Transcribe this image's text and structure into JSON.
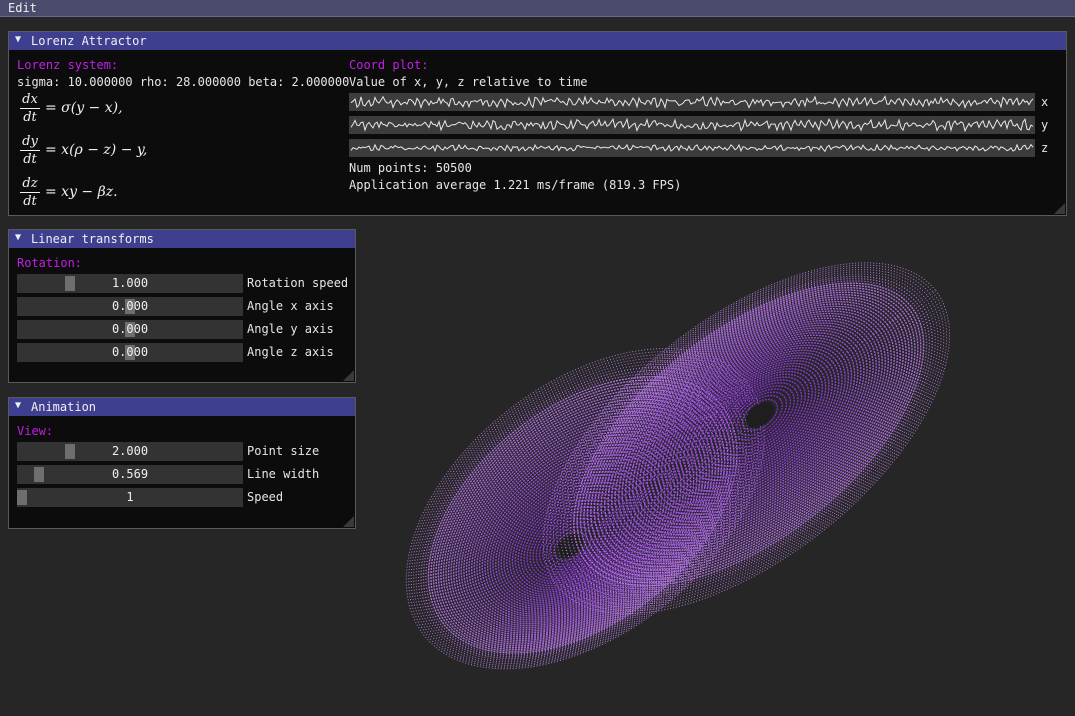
{
  "menubar": {
    "edit": "Edit"
  },
  "lorenz_window": {
    "title": "Lorenz Attractor",
    "system_header": "Lorenz system:",
    "params": "sigma: 10.000000 rho: 28.000000 beta: 2.000000",
    "eq1": {
      "num": "dx",
      "den": "dt",
      "rhs": "= σ(y − x),"
    },
    "eq2": {
      "num": "dy",
      "den": "dt",
      "rhs": "= x(ρ − z) − y,"
    },
    "eq3": {
      "num": "dz",
      "den": "dt",
      "rhs": "= xy − βz."
    },
    "coord_header": "Coord plot:",
    "coord_subtitle": "Value of x, y, z relative to time",
    "plot_labels": [
      "x",
      "y",
      "z"
    ],
    "num_points": "Num points: 50500",
    "fps": "Application average 1.221 ms/frame (819.3 FPS)"
  },
  "linear_window": {
    "title": "Linear transforms",
    "header": "Rotation:",
    "sliders": [
      {
        "label": "Rotation speed",
        "value": "1.000",
        "fraction": 0.22
      },
      {
        "label": "Angle x axis",
        "value": "0.000",
        "fraction": 0.5
      },
      {
        "label": "Angle y axis",
        "value": "0.000",
        "fraction": 0.5
      },
      {
        "label": "Angle z axis",
        "value": "0.000",
        "fraction": 0.5
      }
    ]
  },
  "animation_window": {
    "title": "Animation",
    "header": "View:",
    "sliders": [
      {
        "label": "Point size",
        "value": "2.000",
        "fraction": 0.22
      },
      {
        "label": "Line width",
        "value": "0.569",
        "fraction": 0.08
      },
      {
        "label": "Speed",
        "value": "1",
        "fraction": 0.0
      }
    ]
  },
  "colors": {
    "accent_header": "#c21fe6",
    "titlebar": "#3f3f8f",
    "attractor_inner": "#8a2be2",
    "attractor_outer": "#c98cf5"
  }
}
